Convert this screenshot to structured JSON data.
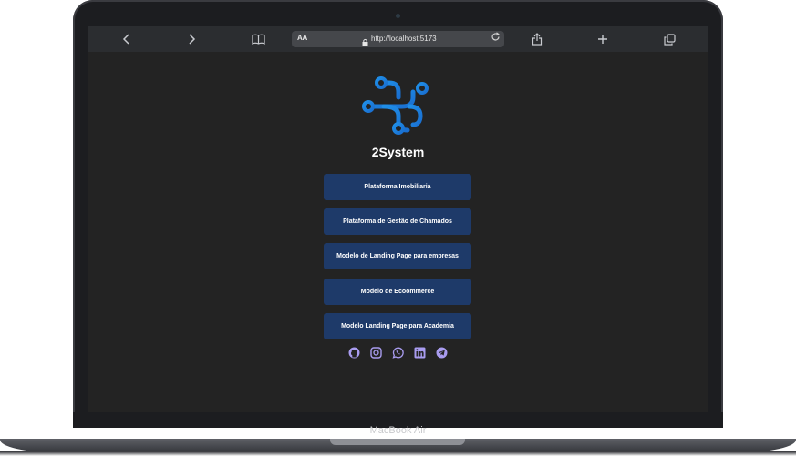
{
  "browser": {
    "url": "http://localhost:5173",
    "text_size_label": "AA",
    "icons": [
      "back-icon",
      "forward-icon",
      "bookmarks-icon",
      "share-icon",
      "new-tab-icon",
      "tabs-icon",
      "lock-icon",
      "reload-icon"
    ]
  },
  "page": {
    "brand": "2System",
    "buttons": [
      {
        "label": "Plataforma Imobiliaria"
      },
      {
        "label": "Plataforma de Gestão de Chamados"
      },
      {
        "label": "Modelo de Landing Page para empresas"
      },
      {
        "label": "Modelo de Ecoommerce"
      },
      {
        "label": "Modelo Landing Page para Academia"
      }
    ],
    "social_icons": [
      "github-icon",
      "instagram-icon",
      "whatsapp-icon",
      "linkedin-icon",
      "telegram-icon"
    ],
    "colors": {
      "background": "#232323",
      "button": "#1e3a69",
      "logo_blue": "#1f8fe8",
      "social": "#a99cf0"
    }
  },
  "device": {
    "label": "MacBook Air"
  }
}
